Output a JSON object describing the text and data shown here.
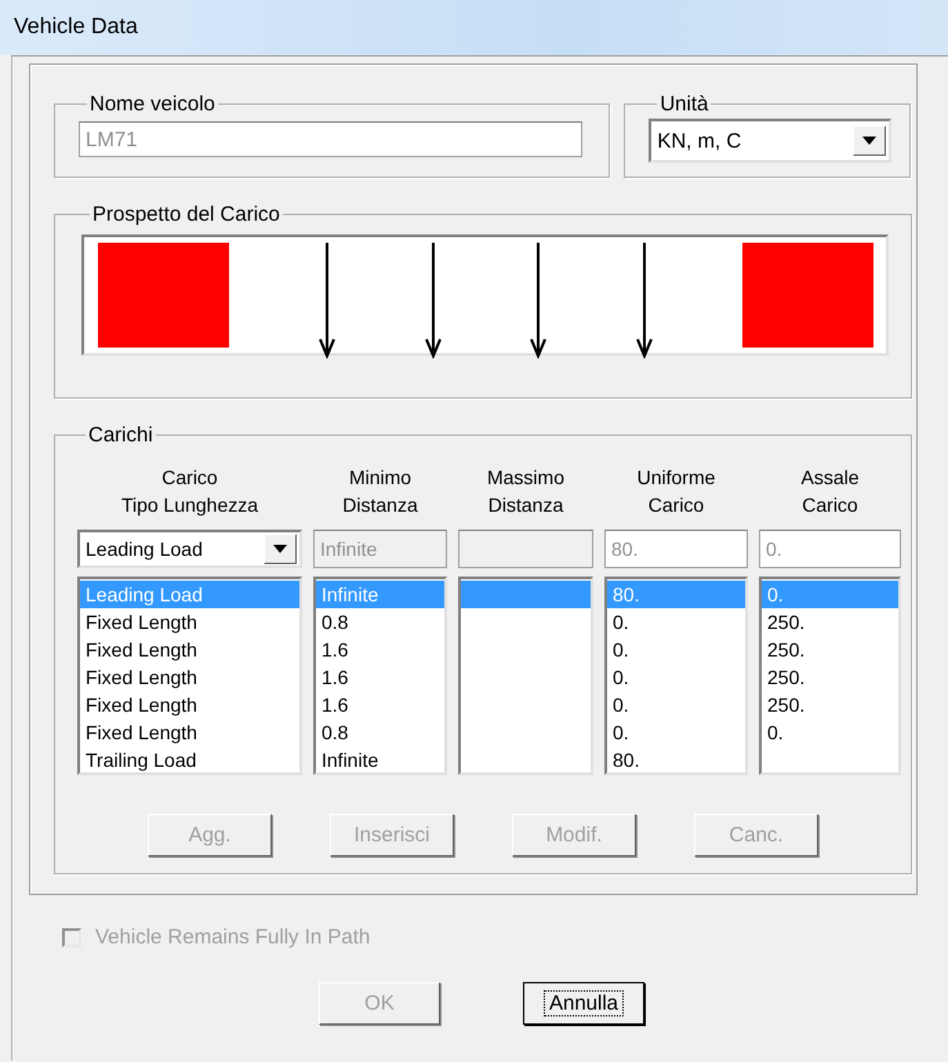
{
  "window": {
    "title": "Vehicle Data"
  },
  "name_group": {
    "label": "Nome veicolo",
    "value": "LM71",
    "disabled": true
  },
  "units_group": {
    "label": "Unità",
    "value": "KN, m, C"
  },
  "diagram_group": {
    "label": "Prospetto del Carico",
    "items": [
      {
        "kind": "block"
      },
      {
        "kind": "arrow"
      },
      {
        "kind": "arrow"
      },
      {
        "kind": "arrow"
      },
      {
        "kind": "arrow"
      },
      {
        "kind": "block"
      }
    ]
  },
  "loads_group": {
    "label": "Carichi",
    "columns": [
      {
        "line1": "Carico",
        "line2": "Tipo Lunghezza"
      },
      {
        "line1": "Minimo",
        "line2": "Distanza"
      },
      {
        "line1": "Massimo",
        "line2": "Distanza"
      },
      {
        "line1": "Uniforme",
        "line2": "Carico"
      },
      {
        "line1": "Assale",
        "line2": "Carico"
      }
    ],
    "editor": {
      "type": "Leading Load",
      "min_distance": "Infinite",
      "min_disabled": true,
      "max_disabled": true,
      "uniform": "80.",
      "axle": "0."
    },
    "rows": [
      {
        "type": "Leading Load",
        "min_distance": "Infinite",
        "uniform": "80.",
        "axle": "0.",
        "selected": true
      },
      {
        "type": "Fixed Length",
        "min_distance": "0.8",
        "uniform": "0.",
        "axle": "250.",
        "selected": false
      },
      {
        "type": "Fixed Length",
        "min_distance": "1.6",
        "uniform": "0.",
        "axle": "250.",
        "selected": false
      },
      {
        "type": "Fixed Length",
        "min_distance": "1.6",
        "uniform": "0.",
        "axle": "250.",
        "selected": false
      },
      {
        "type": "Fixed Length",
        "min_distance": "1.6",
        "uniform": "0.",
        "axle": "250.",
        "selected": false
      },
      {
        "type": "Fixed Length",
        "min_distance": "0.8",
        "uniform": "0.",
        "axle": "0.",
        "selected": false
      },
      {
        "type": "Trailing Load",
        "min_distance": "Infinite",
        "uniform": "80.",
        "selected": false
      }
    ],
    "buttons": [
      {
        "label": "Agg.",
        "disabled": true
      },
      {
        "label": "Inserisci",
        "disabled": true
      },
      {
        "label": "Modif.",
        "disabled": true
      },
      {
        "label": "Canc.",
        "disabled": true
      }
    ]
  },
  "fully_in_path": {
    "label": "Vehicle Remains Fully In Path",
    "checked": false,
    "disabled": true
  },
  "dialog_buttons": [
    {
      "label": "OK",
      "disabled": true,
      "focused": false
    },
    {
      "label": "Annulla",
      "disabled": false,
      "focused": true
    }
  ]
}
